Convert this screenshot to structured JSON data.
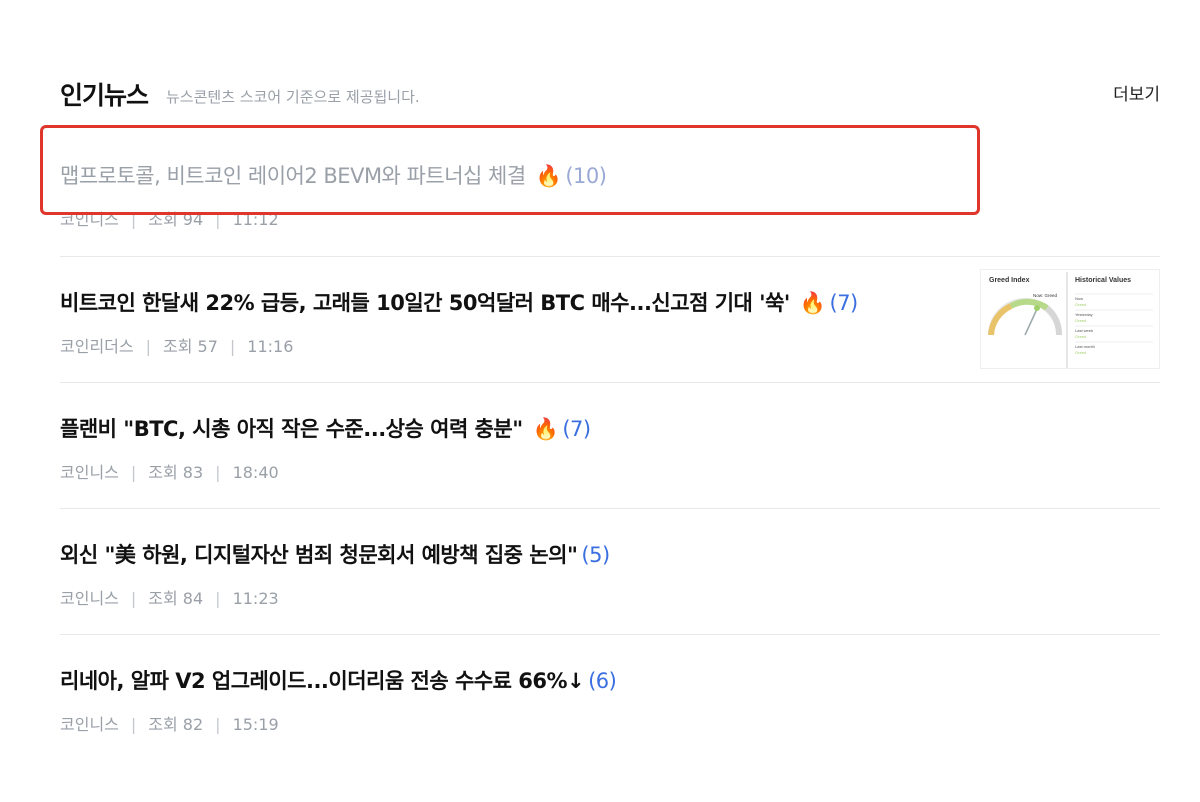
{
  "header": {
    "title": "인기뉴스",
    "subtitle": "뉴스콘텐츠 스코어 기준으로 제공됩니다.",
    "more_label": "더보기"
  },
  "news": [
    {
      "title": "맵프로토콜, 비트코인 레이어2 BEVM와 파트너십 체결",
      "hot": true,
      "count": "(10)",
      "source": "코인니스",
      "views": "조회 94",
      "time": "11:12",
      "visited": true
    },
    {
      "title": "비트코인 한달새 22% 급등, 고래들 10일간 50억달러 BTC 매수...신고점 기대 '쑥'",
      "hot": true,
      "count": "(7)",
      "source": "코인리더스",
      "views": "조회 57",
      "time": "11:16",
      "thumbnail": {
        "title": "Greed Index",
        "subtitle": "Historical Values",
        "now_label": "Now: Greed",
        "rows": [
          {
            "label": "Now",
            "value": "Greed"
          },
          {
            "label": "Yesterday",
            "value": "Greed"
          },
          {
            "label": "Last week",
            "value": "Greed"
          },
          {
            "label": "Last month",
            "value": "Greed"
          }
        ]
      }
    },
    {
      "title": "플랜비 \"BTC, 시총 아직 작은 수준...상승 여력 충분\"",
      "hot": true,
      "count": "(7)",
      "source": "코인니스",
      "views": "조회 83",
      "time": "18:40"
    },
    {
      "title": "외신 \"美 하원, 디지털자산 범죄 청문회서 예방책 집중 논의\"",
      "hot": false,
      "count": "(5)",
      "source": "코인니스",
      "views": "조회 84",
      "time": "11:23"
    },
    {
      "title": "리네아, 알파 V2 업그레이드...이더리움 전송 수수료 66%↓",
      "hot": false,
      "count": "(6)",
      "source": "코인니스",
      "views": "조회 82",
      "time": "15:19"
    }
  ],
  "colors": {
    "accent_count": "#3b6fe0",
    "highlight": "#e0352b",
    "fire": "#ff5a1f"
  },
  "icons": {
    "fire": "fire-icon"
  }
}
